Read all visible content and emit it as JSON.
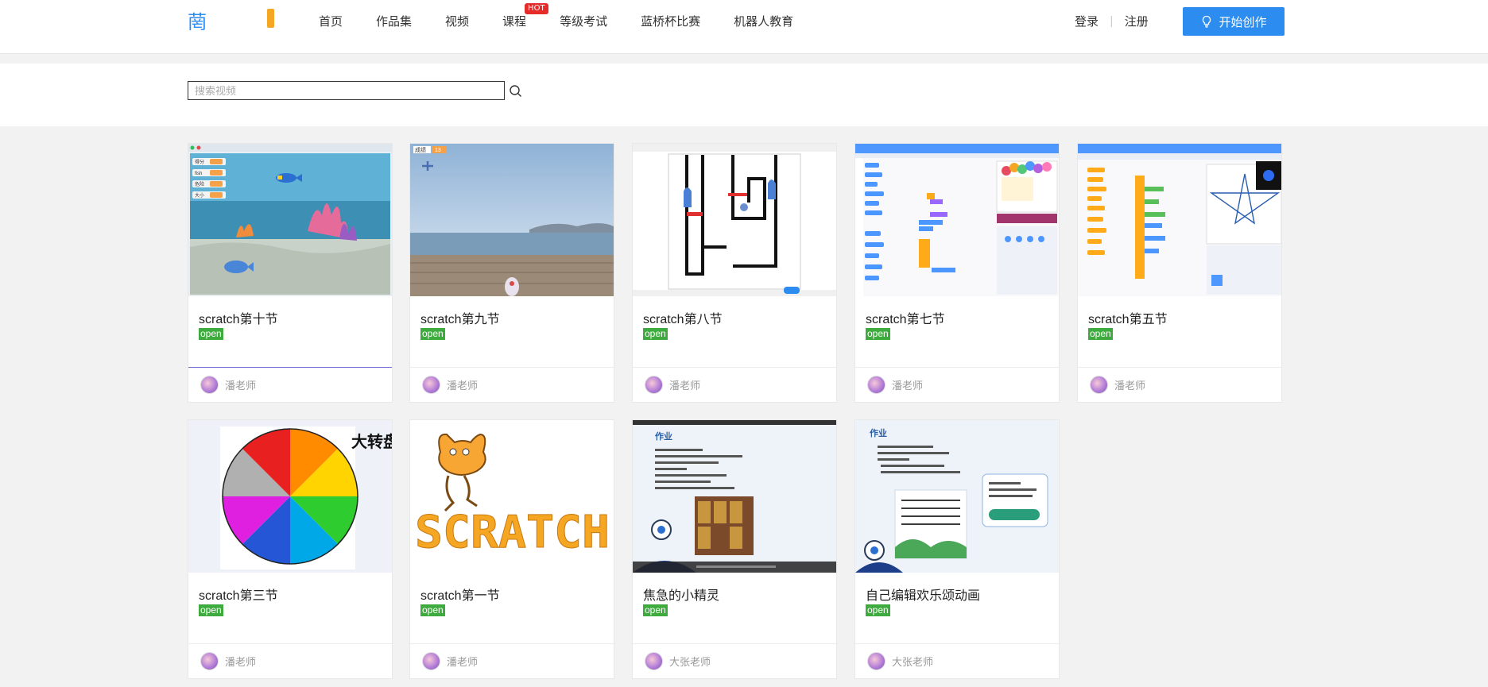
{
  "header": {
    "logo_text": "菵",
    "nav": [
      {
        "label": "首页"
      },
      {
        "label": "作品集"
      },
      {
        "label": "视频"
      },
      {
        "label": "课程",
        "badge": "HOT"
      },
      {
        "label": "等级考试"
      },
      {
        "label": "蓝桥杯比赛"
      },
      {
        "label": "机器人教育"
      }
    ],
    "login": "登录",
    "separator": "|",
    "register": "注册",
    "create_button": "开始创作",
    "create_icon": "lightbulb-icon"
  },
  "search": {
    "placeholder": "搜索视频",
    "value": ""
  },
  "colors": {
    "accent": "#2d8cf0",
    "hot": "#e62b2b",
    "open": "#3dab3d"
  },
  "videos": [
    {
      "title": "scratch第十节",
      "badge": "open",
      "author": "潘老师",
      "thumb": "aquarium-scene"
    },
    {
      "title": "scratch第九节",
      "badge": "open",
      "author": "潘老师",
      "thumb": "seaside-boardwalk",
      "thumb_labels": [
        "成绩",
        "13"
      ]
    },
    {
      "title": "scratch第八节",
      "badge": "open",
      "author": "潘老师",
      "thumb": "maze-game"
    },
    {
      "title": "scratch第七节",
      "badge": "open",
      "author": "潘老师",
      "thumb": "scratch-editor-balloons"
    },
    {
      "title": "scratch第五节",
      "badge": "open",
      "author": "潘老师",
      "thumb": "scratch-editor-star"
    },
    {
      "title": "scratch第三节",
      "badge": "open",
      "author": "潘老师",
      "thumb": "lucky-wheel",
      "thumb_labels": [
        "大转盘"
      ]
    },
    {
      "title": "scratch第一节",
      "badge": "open",
      "author": "潘老师",
      "thumb": "scratch-logo",
      "thumb_labels": [
        "SCRATCH"
      ]
    },
    {
      "title": "焦急的小精灵",
      "badge": "open",
      "author": "大张老师",
      "thumb": "homework-slide-library",
      "thumb_labels": [
        "作业"
      ]
    },
    {
      "title": "自己编辑欢乐颂动画",
      "badge": "open",
      "author": "大张老师",
      "thumb": "homework-slide-music",
      "thumb_labels": [
        "作业"
      ]
    }
  ]
}
